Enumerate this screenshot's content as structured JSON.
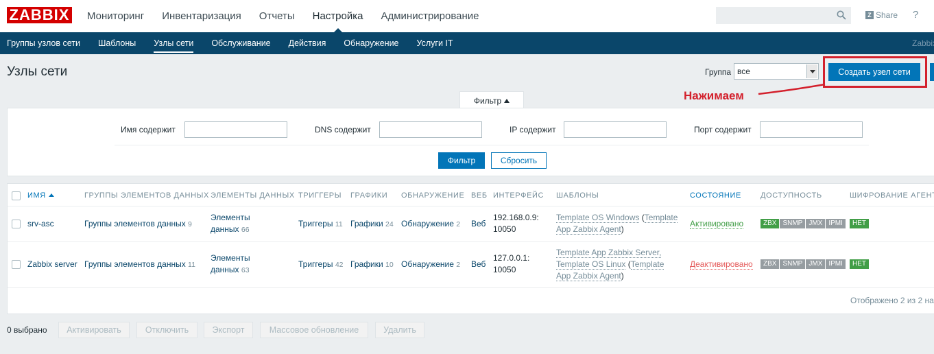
{
  "brand": {
    "logo_text": "ZABBIX",
    "accent": "#d40000",
    "nav_bg": "#0a466a",
    "primary_btn": "#0275b8"
  },
  "top_menu": {
    "items": [
      {
        "label": "Мониторинг"
      },
      {
        "label": "Инвентаризация"
      },
      {
        "label": "Отчеты"
      },
      {
        "label": "Настройка"
      },
      {
        "label": "Администрирование"
      }
    ],
    "active_index": 3,
    "share_label": "Share",
    "help_label": "?"
  },
  "sub_menu": {
    "items": [
      {
        "label": "Группы узлов сети"
      },
      {
        "label": "Шаблоны"
      },
      {
        "label": "Узлы сети"
      },
      {
        "label": "Обслуживание"
      },
      {
        "label": "Действия"
      },
      {
        "label": "Обнаружение"
      },
      {
        "label": "Услуги IT"
      }
    ],
    "active_index": 2,
    "right_cut_text": "Zabbix"
  },
  "header": {
    "title": "Узлы сети",
    "group_label": "Группа",
    "group_value": "все",
    "create_button": "Создать узел сети"
  },
  "annotation": {
    "text": "Нажимаем",
    "color": "#d3202c"
  },
  "filter": {
    "tab_label": "Фильтр",
    "fields": [
      {
        "label": "Имя содержит",
        "value": ""
      },
      {
        "label": "DNS содержит",
        "value": ""
      },
      {
        "label": "IP содержит",
        "value": ""
      },
      {
        "label": "Порт содержит",
        "value": ""
      }
    ],
    "apply_button": "Фильтр",
    "reset_button": "Сбросить"
  },
  "table": {
    "headers": {
      "name": "ИМЯ",
      "item_groups": "ГРУППЫ ЭЛЕМЕНТОВ ДАННЫХ",
      "items": "ЭЛЕМЕНТЫ ДАННЫХ",
      "triggers": "ТРИГГЕРЫ",
      "graphs": "ГРАФИКИ",
      "discovery": "ОБНАРУЖЕНИЕ",
      "web": "ВЕБ",
      "interface": "ИНТЕРФЕЙС",
      "templates": "ШАБЛОНЫ",
      "status": "СОСТОЯНИЕ",
      "availability": "ДОСТУПНОСТЬ",
      "encryption": "ШИФРОВАНИЕ АГЕНТА"
    },
    "rows": [
      {
        "name": "srv-asc",
        "item_groups": "Группы элементов данных",
        "item_groups_count": "9",
        "items_line1": "Элементы",
        "items_line2": "данных",
        "items_count": "66",
        "triggers": "Триггеры",
        "triggers_count": "11",
        "graphs": "Графики",
        "graphs_count": "24",
        "discovery": "Обнаружение",
        "discovery_count": "2",
        "web": "Веб",
        "interface_line1": "192.168.0.9:",
        "interface_line2": "10050",
        "tpl1": "Template OS Windows",
        "tpl1_open": " (",
        "tpl1_inner": "Template",
        "tpl1_inner2": "App Zabbix Agent",
        "tpl1_close": ")",
        "status": "Активировано",
        "avail": [
          "ZBX",
          "SNMP",
          "JMX",
          "IPMI"
        ],
        "encryption": "НЕТ"
      },
      {
        "name": "Zabbix server",
        "item_groups": "Группы элементов данных",
        "item_groups_count": "11",
        "items_line1": "Элементы",
        "items_line2": "данных",
        "items_count": "63",
        "triggers": "Триггеры",
        "triggers_count": "42",
        "graphs": "Графики",
        "graphs_count": "10",
        "discovery": "Обнаружение",
        "discovery_count": "2",
        "web": "Веб",
        "interface_line1": "127.0.0.1:",
        "interface_line2": "10050",
        "tpl1": "Template App Zabbix Server,",
        "tpl2": "Template OS Linux",
        "tpl2_open": " (",
        "tpl2_inner": "Template",
        "tpl2_inner2": "App Zabbix Agent",
        "tpl2_close": ")",
        "status": "Деактивировано",
        "avail": [
          "ZBX",
          "SNMP",
          "JMX",
          "IPMI"
        ],
        "encryption": "НЕТ"
      }
    ],
    "shown_text": "Отображено 2 из 2 на"
  },
  "footer": {
    "selected_count": "0 выбрано",
    "buttons": [
      "Активировать",
      "Отключить",
      "Экспорт",
      "Массовое обновление",
      "Удалить"
    ]
  }
}
